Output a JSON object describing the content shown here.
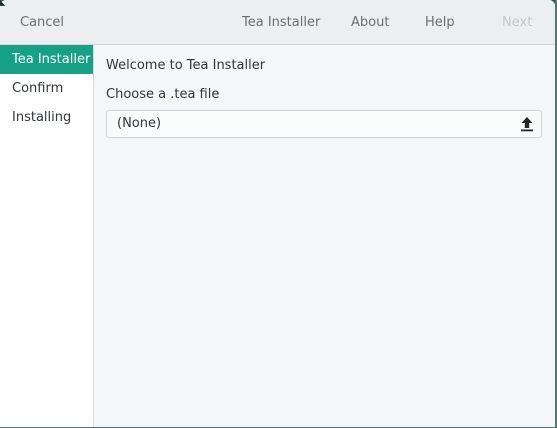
{
  "header": {
    "cancel_label": "Cancel",
    "title": "Tea Installer",
    "about_label": "About",
    "help_label": "Help",
    "next_label": "Next"
  },
  "sidebar": {
    "items": [
      {
        "label": "Tea Installer",
        "active": true
      },
      {
        "label": "Confirm",
        "active": false
      },
      {
        "label": "Installing",
        "active": false
      }
    ]
  },
  "main": {
    "welcome_text": "Welcome to Tea Installer",
    "choose_label": "Choose a .tea file",
    "file_value": "(None)",
    "upload_icon": "upload-icon"
  },
  "colors": {
    "accent": "#16a085",
    "header_bg": "#eceeef",
    "content_bg": "#f5f6f7",
    "sidebar_bg": "#ffffff"
  }
}
